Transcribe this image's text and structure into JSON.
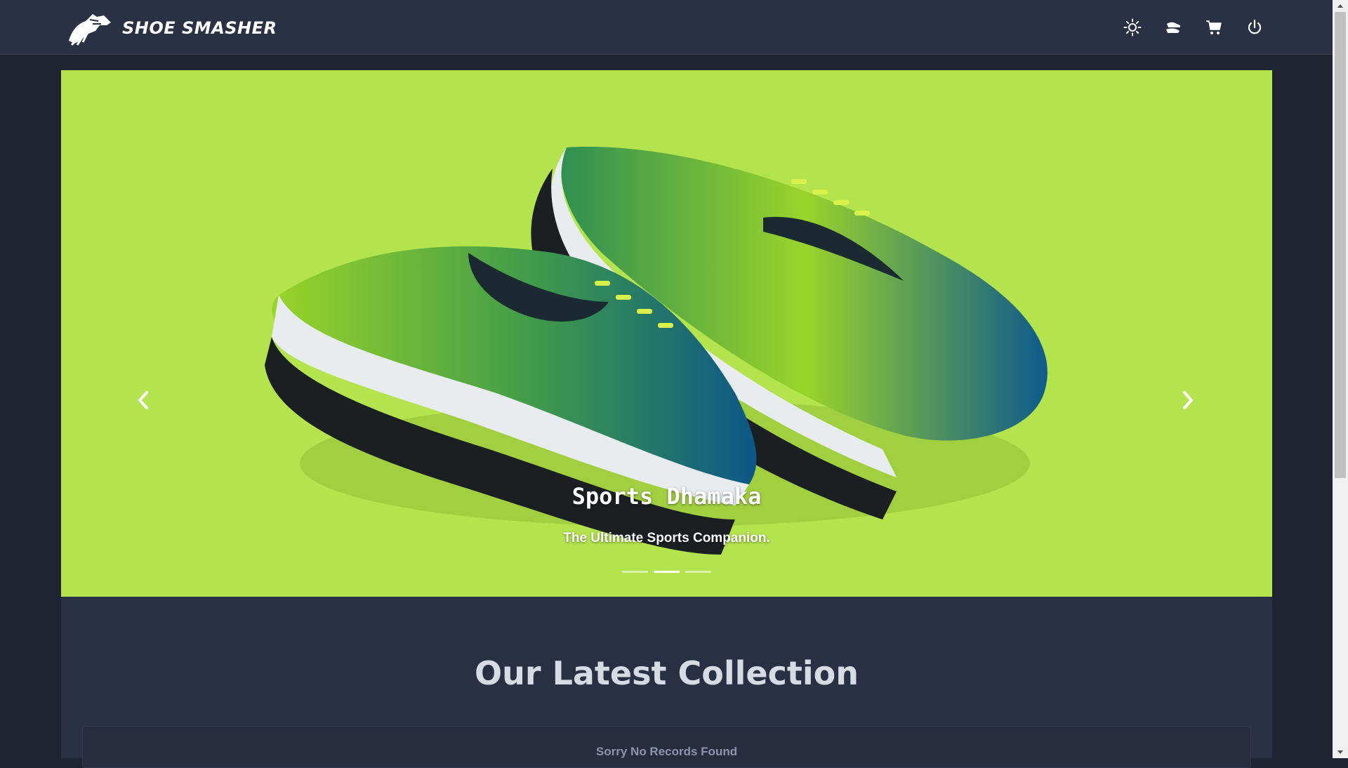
{
  "header": {
    "brand_name": "SHOE SMASHER",
    "icons": [
      "sun-icon",
      "sneaker-icon",
      "cart-icon",
      "power-icon"
    ]
  },
  "carousel": {
    "slide_title": "Sports Dhamaka",
    "slide_subtitle": "The Ultimate Sports Companion.",
    "indicators": 3,
    "active_indicator": 2,
    "background_color": "#b3e34d"
  },
  "collection": {
    "title": "Our Latest Collection",
    "empty_message": "Sorry No Records Found"
  },
  "colors": {
    "page_bg": "#1f2433",
    "navbar_bg": "#2a3144",
    "accent_green": "#b3e34d",
    "shoe_blue": "#0f5a8a"
  }
}
